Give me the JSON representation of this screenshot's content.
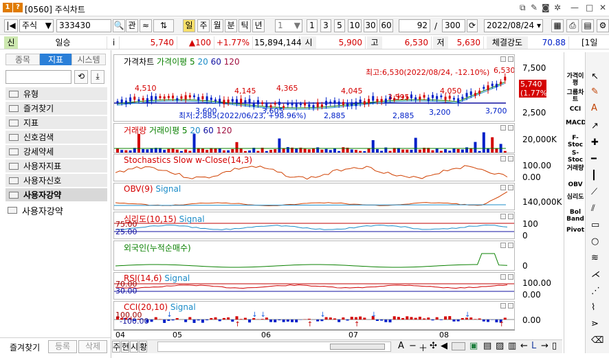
{
  "window": {
    "badge1": "1",
    "badge2": "?",
    "title": "[0560] 주식차트"
  },
  "toolbar": {
    "market": "주식",
    "code": "333430",
    "btn_gwan": "관",
    "name": "일승",
    "period_active": "일",
    "periods": [
      "주",
      "월",
      "분",
      "틱",
      "년"
    ],
    "count_sel": "1",
    "nums": [
      "1",
      "3",
      "5",
      "10",
      "30",
      "60"
    ],
    "qty": "92",
    "slash": "/",
    "total": "300",
    "date": "2022/08/24"
  },
  "price": {
    "label_sin": "신",
    "info": "i",
    "close": "5,740",
    "change": "▲100",
    "rate": "+1.77%",
    "volume": "15,894,144",
    "open_label": "시",
    "open": "5,900",
    "high_label": "고",
    "high": "6,530",
    "low_label": "저",
    "low": "5,630",
    "strength_label": "체결강도",
    "strength": "70.88",
    "extra": "[1일"
  },
  "left": {
    "tabs": [
      "종목",
      "지표",
      "시스템"
    ],
    "folders": [
      "유형",
      "즐겨찾기",
      "지표",
      "신호검색",
      "강세약세",
      "사용자지표",
      "사용자신호",
      "사용자강약"
    ],
    "tree_item": "사용자강약",
    "footer": [
      "즐겨찾기",
      "등록",
      "삭제"
    ]
  },
  "panels": {
    "price": {
      "title": "가격차트",
      "ma_title": "가격이평 5",
      "ma2": "20",
      "ma3": "60",
      "ma4": "120",
      "high_note": "최고:6,530(2022/08/24, -12.10%)",
      "low_note": "최저:2,885(2022/06/23, +98.96%)",
      "current_box1": "5,740",
      "current_box2": "(1.77%)",
      "ann": [
        "4,510",
        "4,145",
        "4,365",
        "4,045",
        "3,595",
        "4,050",
        "6,530",
        "3,600",
        "3,605",
        "2,885",
        "2,885",
        "3,200",
        "3,700"
      ],
      "axis": [
        "7,500",
        "2,500"
      ]
    },
    "volume": {
      "title": "거래량",
      "ma_title": "거래이평 5",
      "ma2": "20",
      "ma3": "60",
      "ma4": "120",
      "axis": "20,000K"
    },
    "stoch": {
      "title": "Stochastics Slow w-Close(14,3)",
      "axis": [
        "100.00",
        "0.00"
      ]
    },
    "obv": {
      "title": "OBV(9)",
      "sig": "Signal",
      "axis": "140,000K"
    },
    "psy": {
      "title": "심리도(10,15)",
      "sig": "Signal",
      "lvl1": "75.00",
      "lvl2": "25.00",
      "axis": [
        "100",
        "0"
      ]
    },
    "foreign": {
      "title": "외국인(누적순매수)",
      "axis": "0"
    },
    "rsi": {
      "title": "RSI(14,6)",
      "sig": "Signal",
      "lvl1": "70.00",
      "lvl2": "30.00",
      "axis": [
        "100.00",
        "0.00"
      ]
    },
    "cci": {
      "title": "CCI(20,10)",
      "sig": "Signal",
      "lvl1": "100.00",
      "lvl2": "-100.00",
      "axis": "0.00"
    }
  },
  "xaxis": [
    "04",
    "05",
    "06",
    "07",
    "08"
  ],
  "bottom": {
    "tabs": [
      "주",
      "현",
      "시",
      "황"
    ],
    "zoom": "A"
  },
  "right_indicators": [
    "가격이평",
    "그룹차트",
    "CCI",
    "MACD",
    "F-Stoc",
    "S-Stoc",
    "거래량",
    "OBV",
    "심리도",
    "Bol Band",
    "Pivot"
  ],
  "colors": {
    "up": "#d40000",
    "down": "#0020c8",
    "accent": "#f0d000"
  }
}
